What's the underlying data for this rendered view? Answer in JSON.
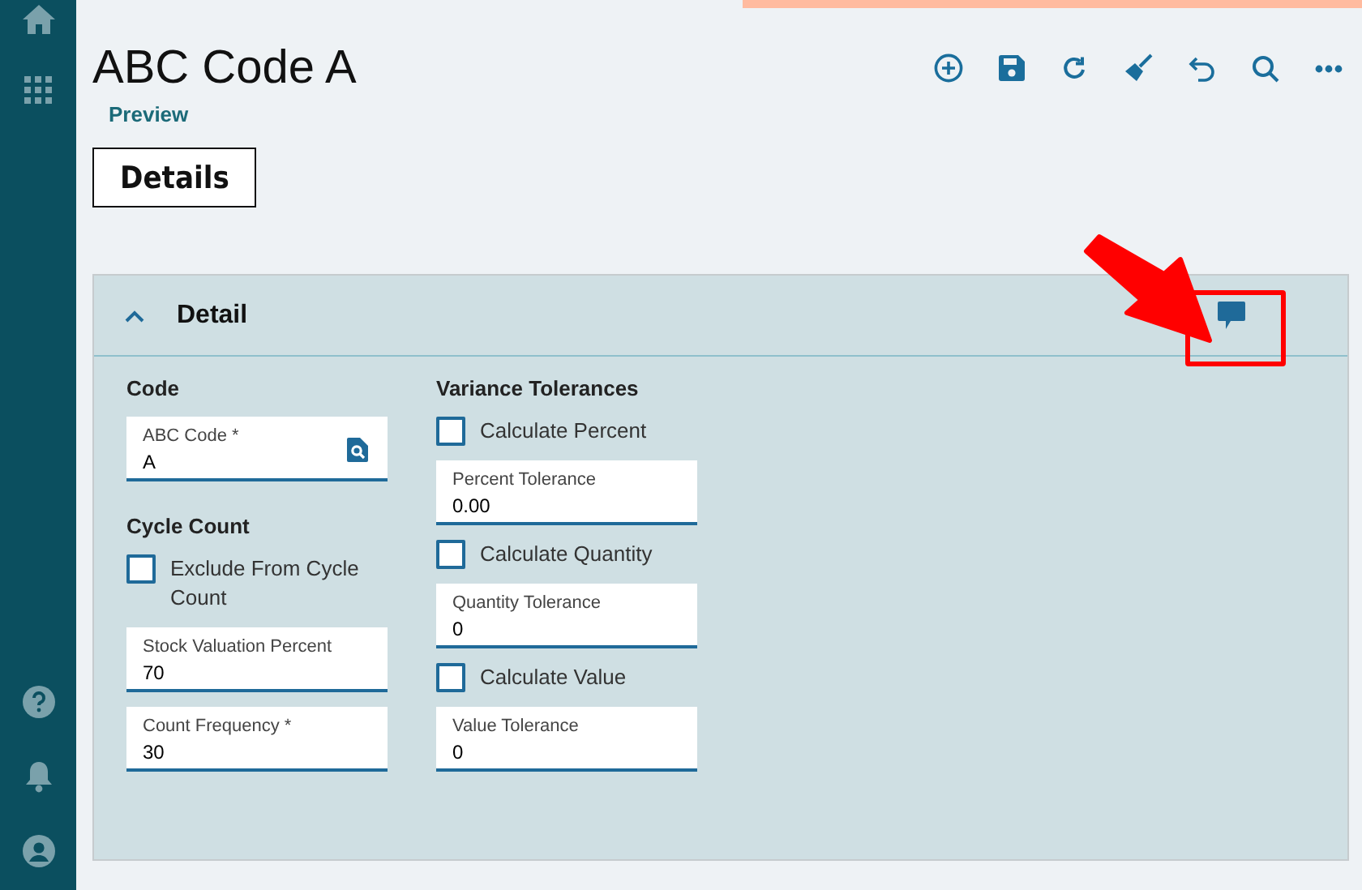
{
  "page": {
    "title": "ABC Code A",
    "link": "Preview"
  },
  "tabs": [
    {
      "label": "Details",
      "selected": true
    }
  ],
  "panel": {
    "title": "Detail",
    "expanded": true,
    "columns": [
      {
        "sections": [
          {
            "heading": "Code",
            "items": [
              {
                "kind": "field",
                "label": "ABC Code *",
                "value": "A",
                "lookup": true
              }
            ]
          },
          {
            "heading": "Cycle Count",
            "items": [
              {
                "kind": "checkbox",
                "label": "Exclude From Cycle Count",
                "checked": false
              },
              {
                "kind": "field",
                "label": "Stock Valuation Percent",
                "value": "70",
                "lookup": false
              },
              {
                "kind": "field",
                "label": "Count Frequency *",
                "value": "30",
                "lookup": false
              }
            ]
          }
        ]
      },
      {
        "sections": [
          {
            "heading": "Variance Tolerances",
            "items": [
              {
                "kind": "checkbox",
                "label": "Calculate Percent",
                "checked": false
              },
              {
                "kind": "field",
                "label": "Percent Tolerance",
                "value": "0.00",
                "lookup": false
              },
              {
                "kind": "checkbox",
                "label": "Calculate Quantity",
                "checked": false
              },
              {
                "kind": "field",
                "label": "Quantity Tolerance",
                "value": "0",
                "lookup": false
              },
              {
                "kind": "checkbox",
                "label": "Calculate Value",
                "checked": false
              },
              {
                "kind": "field",
                "label": "Value Tolerance",
                "value": "0",
                "lookup": false
              }
            ]
          }
        ]
      }
    ]
  }
}
